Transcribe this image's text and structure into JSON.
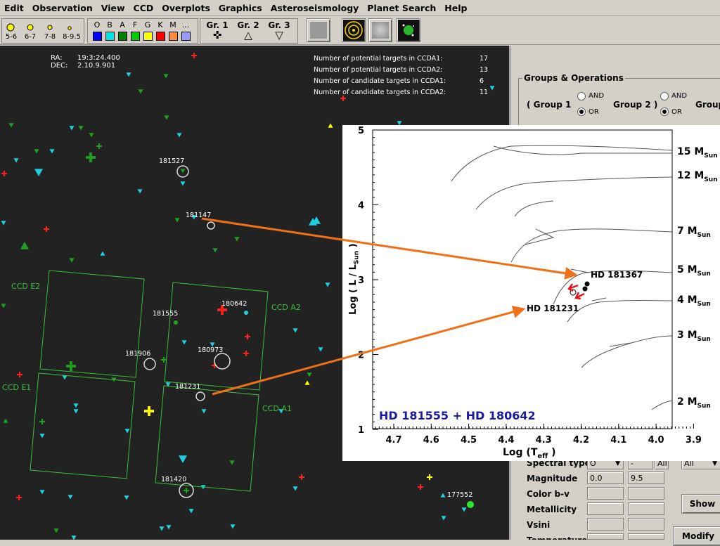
{
  "menu": [
    "Edit",
    "Observation",
    "View",
    "CCD",
    "Overplots",
    "Graphics",
    "Asteroseismology",
    "Planet Search",
    "Help"
  ],
  "toolbar": {
    "magnitude_labels": [
      "5-6",
      "6-7",
      "7-8",
      "8-9.5"
    ],
    "spectral_types": [
      "O",
      "B",
      "A",
      "F",
      "G",
      "K",
      "M",
      "..."
    ],
    "spectral_colors": [
      "#0000ff",
      "#00e5e5",
      "#008000",
      "#00cc00",
      "#ffff00",
      "#ff0000",
      "#ff8c40",
      "#9999ff"
    ],
    "groups": [
      {
        "label": "Gr. 1",
        "symbol": "✜"
      },
      {
        "label": "Gr. 2",
        "symbol": "△"
      },
      {
        "label": "Gr. 3",
        "symbol": "▽"
      }
    ]
  },
  "sky": {
    "ra_label": "RA:",
    "ra_value": "19:3:24.400",
    "dec_label": "DEC:",
    "dec_value": "2.10.9.901",
    "counts": [
      {
        "label": "Number of potential targets in CCDA1:",
        "value": "17"
      },
      {
        "label": "Number of potential targets in CCDA2:",
        "value": "13"
      },
      {
        "label": "Number of candidate targets in CCDA1:",
        "value": "6"
      },
      {
        "label": "Number of candidate targets in CCDA2:",
        "value": "11"
      }
    ],
    "ccd_labels": [
      "CCD E2",
      "CCD A2",
      "CCD E1",
      "CCD A1"
    ],
    "star_labels": [
      "181527",
      "181147",
      "181555",
      "180642",
      "181906",
      "180973",
      "181231",
      "181420",
      "177552"
    ]
  },
  "panel": {
    "groups_title": "Groups & Operations",
    "group1": "( Group 1",
    "group2": "Group 2 )",
    "group3": "Group",
    "and": "AND",
    "or": "OR",
    "rows": [
      {
        "label": "Spectral type",
        "v1": "O",
        "v2": "-",
        "v3": "All",
        "v4": "All"
      },
      {
        "label": "Magnitude",
        "v1": "0.0",
        "v2": "9.5"
      },
      {
        "label": "Color b-v",
        "v1": "",
        "v2": ""
      },
      {
        "label": "Metallicity",
        "v1": "",
        "v2": ""
      },
      {
        "label": "Vsini",
        "v1": "",
        "v2": ""
      },
      {
        "label": "Temperature",
        "v1": "",
        "v2": ""
      }
    ],
    "show_button": "Show",
    "modify_button": "Modify"
  },
  "hr": {
    "y_label": "Log ( L / L",
    "y_label_sub": "Sun",
    "x_label": "Log (T",
    "x_label_sub": "eff",
    "x_ticks": [
      "4.7",
      "4.6",
      "4.5",
      "4.4",
      "4.3",
      "4.2",
      "4.1",
      "4.0",
      "3.9"
    ],
    "y_ticks": [
      "5",
      "4",
      "3",
      "2",
      "1"
    ],
    "mass_labels": [
      "15 M",
      "12 M",
      "7 M",
      "5 M",
      "4 M",
      "3 M",
      "2 M"
    ],
    "mass_sub": "Sun",
    "star_a": "HD 181367",
    "star_b": "HD 181231",
    "caption": "HD 181555 + HD 180642",
    "arrow_color": "#f07018",
    "caption_color": "#1a1aa0"
  }
}
